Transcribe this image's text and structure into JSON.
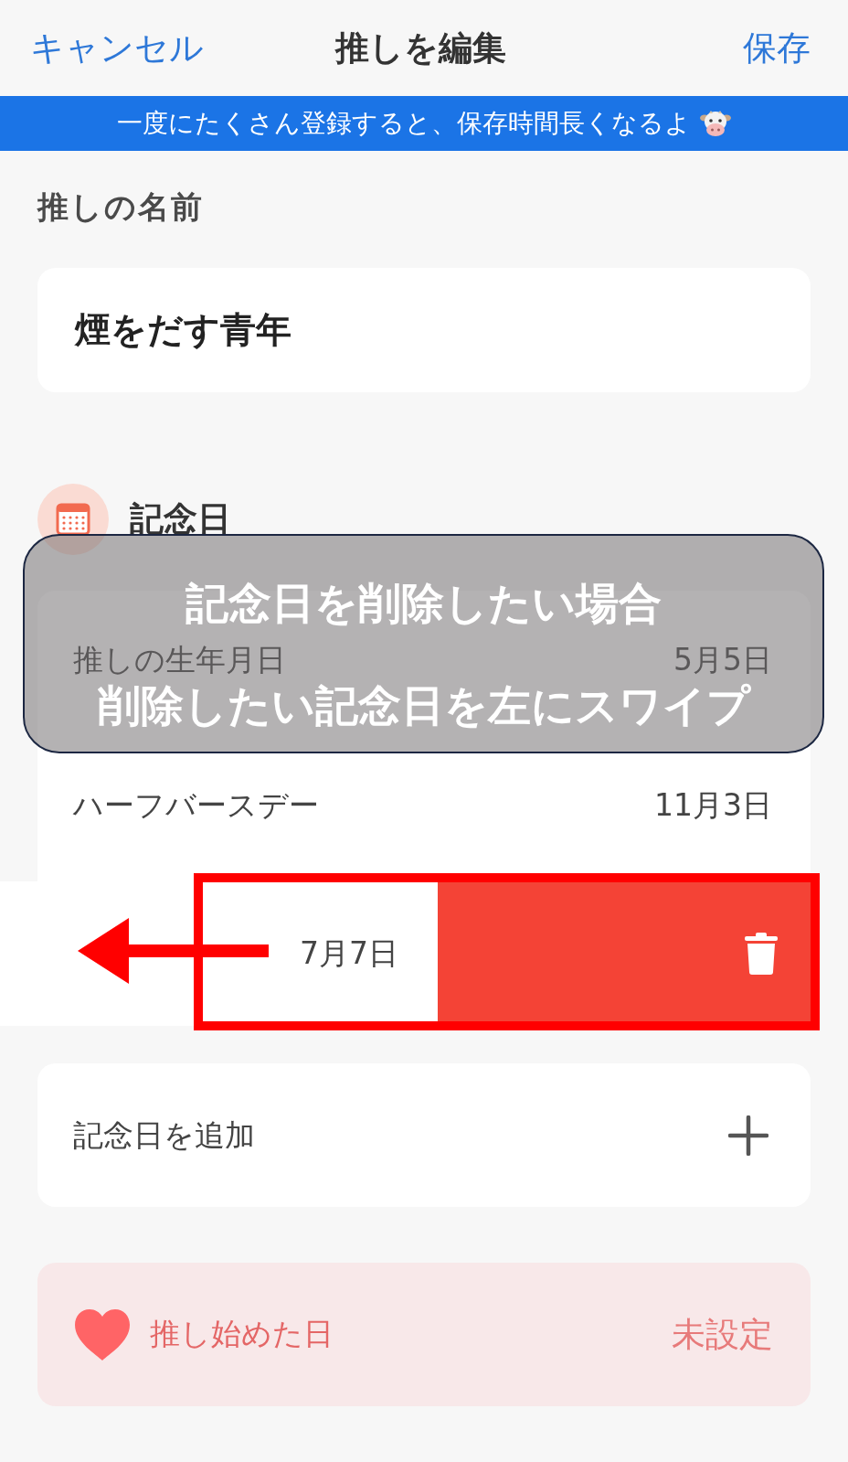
{
  "nav": {
    "cancel": "キャンセル",
    "title": "推しを編集",
    "save": "保存"
  },
  "banner": {
    "text": "一度にたくさん登録すると、保存時間長くなるよ"
  },
  "name_section": {
    "label": "推しの名前",
    "value": "煙をだす青年"
  },
  "anniversaries": {
    "title": "記念日",
    "items": [
      {
        "name": "推しの生年月日",
        "date": "5月5日",
        "swiped": false
      },
      {
        "name": "ハーフバースデー",
        "date": "11月3日",
        "swiped": false
      },
      {
        "date": "7月7日",
        "swiped": true
      }
    ],
    "add_label": "記念日を追加"
  },
  "start_date": {
    "label": "推し始めた日",
    "value": "未設定"
  },
  "annotation": {
    "lines": [
      "記念日を削除したい場合",
      "削除したい記念日を左にスワイプ"
    ]
  }
}
